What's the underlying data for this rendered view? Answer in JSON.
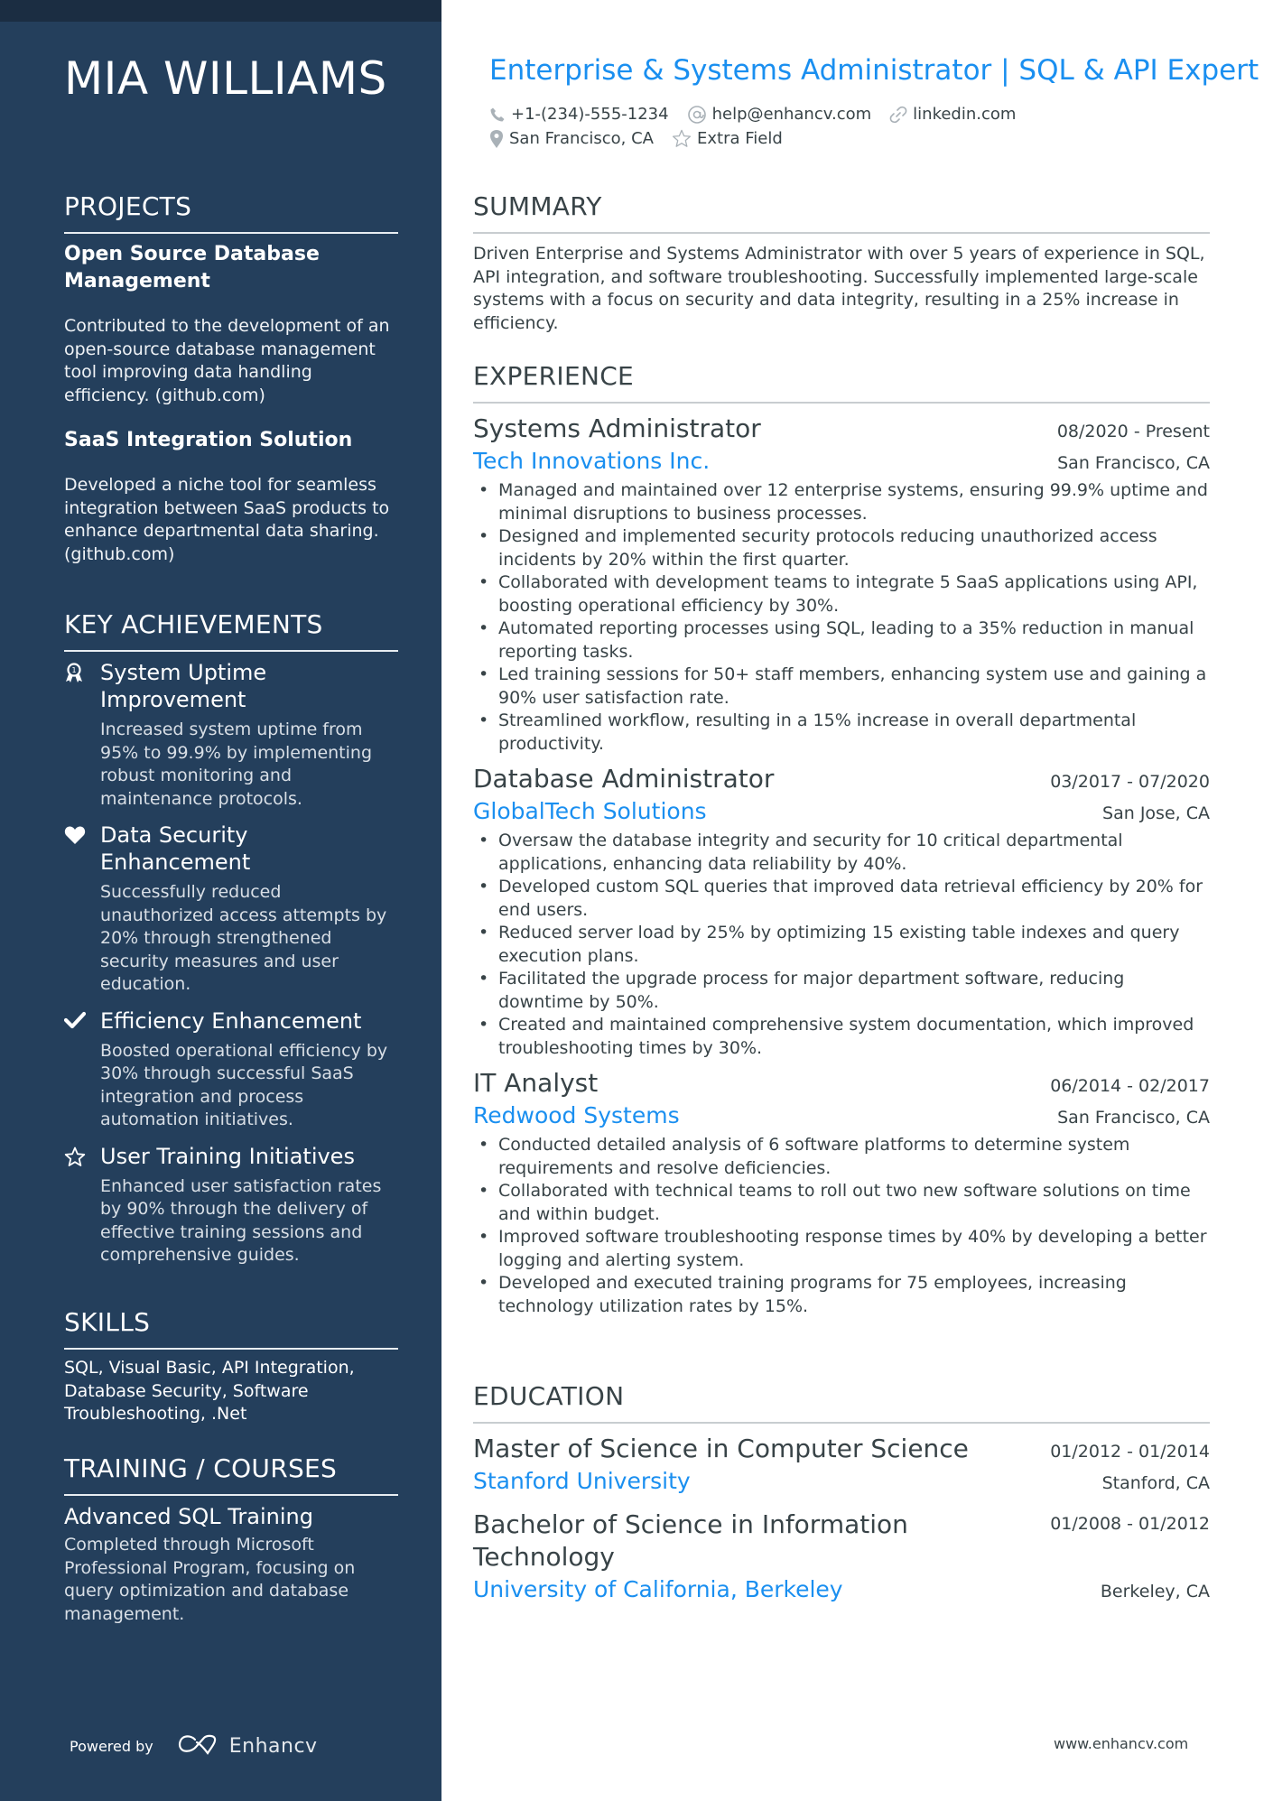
{
  "name": "MIA WILLIAMS",
  "title": "Enterprise & Systems Administrator | SQL & API Expert",
  "contacts": {
    "phone": {
      "icon": "phone-icon",
      "value": "+1-(234)-555-1234"
    },
    "email": {
      "icon": "at-icon",
      "value": "help@enhancv.com"
    },
    "link": {
      "icon": "link-icon",
      "value": "linkedin.com"
    },
    "location": {
      "icon": "map-pin-icon",
      "value": "San Francisco, CA"
    },
    "extra": {
      "icon": "star-icon",
      "value": "Extra Field"
    }
  },
  "colors": {
    "sidebar": "#243f5c",
    "sidebar_strip": "#1b2d42",
    "accent": "#1a8ff0",
    "text": "#384347"
  },
  "sidebar": {
    "projects": {
      "heading": "PROJECTS",
      "items": [
        {
          "title": "Open Source Database Management",
          "description": "Contributed to the development of an open-source database management tool improving data handling efficiency. (github.com)"
        },
        {
          "title": "SaaS Integration Solution",
          "description": "Developed a niche tool for seamless integration between SaaS products to enhance departmental data sharing. (github.com)"
        }
      ]
    },
    "achievements": {
      "heading": "KEY ACHIEVEMENTS",
      "items": [
        {
          "icon": "award-ribbon-icon",
          "title": "System Uptime Improvement",
          "description": "Increased system uptime from 95% to 99.9% by implementing robust monitoring and maintenance protocols."
        },
        {
          "icon": "heart-icon",
          "title": "Data Security Enhancement",
          "description": "Successfully reduced unauthorized access attempts by 20% through strengthened security measures and user education."
        },
        {
          "icon": "checkmark-icon",
          "title": "Efficiency Enhancement",
          "description": "Boosted operational efficiency by 30% through successful SaaS integration and process automation initiatives."
        },
        {
          "icon": "star-outline-icon",
          "title": "User Training Initiatives",
          "description": "Enhanced user satisfaction rates by 90% through the delivery of effective training sessions and comprehensive guides."
        }
      ]
    },
    "skills": {
      "heading": "SKILLS",
      "text": "SQL, Visual Basic, API Integration, Database Security, Software Troubleshooting, .Net"
    },
    "training": {
      "heading": "TRAINING / COURSES",
      "items": [
        {
          "title": "Advanced SQL Training",
          "description": "Completed through Microsoft Professional Program, focusing on query optimization and database management."
        }
      ]
    },
    "powered_by": "Powered by",
    "brand": "Enhancv"
  },
  "summary": {
    "heading": "SUMMARY",
    "text": "Driven Enterprise and Systems Administrator with over 5 years of experience in SQL, API integration, and software troubleshooting. Successfully implemented large-scale systems with a focus on security and data integrity, resulting in a 25% increase in efficiency."
  },
  "experience": {
    "heading": "EXPERIENCE",
    "jobs": [
      {
        "title": "Systems Administrator",
        "dates": "08/2020 - Present",
        "company": "Tech Innovations Inc.",
        "location": "San Francisco, CA",
        "bullets": [
          "Managed and maintained over 12 enterprise systems, ensuring 99.9% uptime and minimal disruptions to business processes.",
          "Designed and implemented security protocols reducing unauthorized access incidents by 20% within the first quarter.",
          "Collaborated with development teams to integrate 5 SaaS applications using API, boosting operational efficiency by 30%.",
          "Automated reporting processes using SQL, leading to a 35% reduction in manual reporting tasks.",
          "Led training sessions for 50+ staff members, enhancing system use and gaining a 90% user satisfaction rate.",
          "Streamlined workflow, resulting in a 15% increase in overall departmental productivity."
        ]
      },
      {
        "title": "Database Administrator",
        "dates": "03/2017 - 07/2020",
        "company": "GlobalTech Solutions",
        "location": "San Jose, CA",
        "bullets": [
          "Oversaw the database integrity and security for 10 critical departmental applications, enhancing data reliability by 40%.",
          "Developed custom SQL queries that improved data retrieval efficiency by 20% for end users.",
          "Reduced server load by 25% by optimizing 15 existing table indexes and query execution plans.",
          "Facilitated the upgrade process for major department software, reducing downtime by 50%.",
          "Created and maintained comprehensive system documentation, which improved troubleshooting times by 30%."
        ]
      },
      {
        "title": "IT Analyst",
        "dates": "06/2014 - 02/2017",
        "company": "Redwood Systems",
        "location": "San Francisco, CA",
        "bullets": [
          "Conducted detailed analysis of 6 software platforms to determine system requirements and resolve deficiencies.",
          "Collaborated with technical teams to roll out two new software solutions on time and within budget.",
          "Improved software troubleshooting response times by 40% by developing a better logging and alerting system.",
          "Developed and executed training programs for 75 employees, increasing technology utilization rates by 15%."
        ]
      }
    ]
  },
  "education": {
    "heading": "EDUCATION",
    "items": [
      {
        "degree": "Master of Science in Computer Science",
        "dates": "01/2012 - 01/2014",
        "school": "Stanford University",
        "location": "Stanford, CA"
      },
      {
        "degree": "Bachelor of Science in Information Technology",
        "dates": "01/2008 - 01/2012",
        "school": "University of California, Berkeley",
        "location": "Berkeley, CA"
      }
    ]
  },
  "footer_url": "www.enhancv.com"
}
